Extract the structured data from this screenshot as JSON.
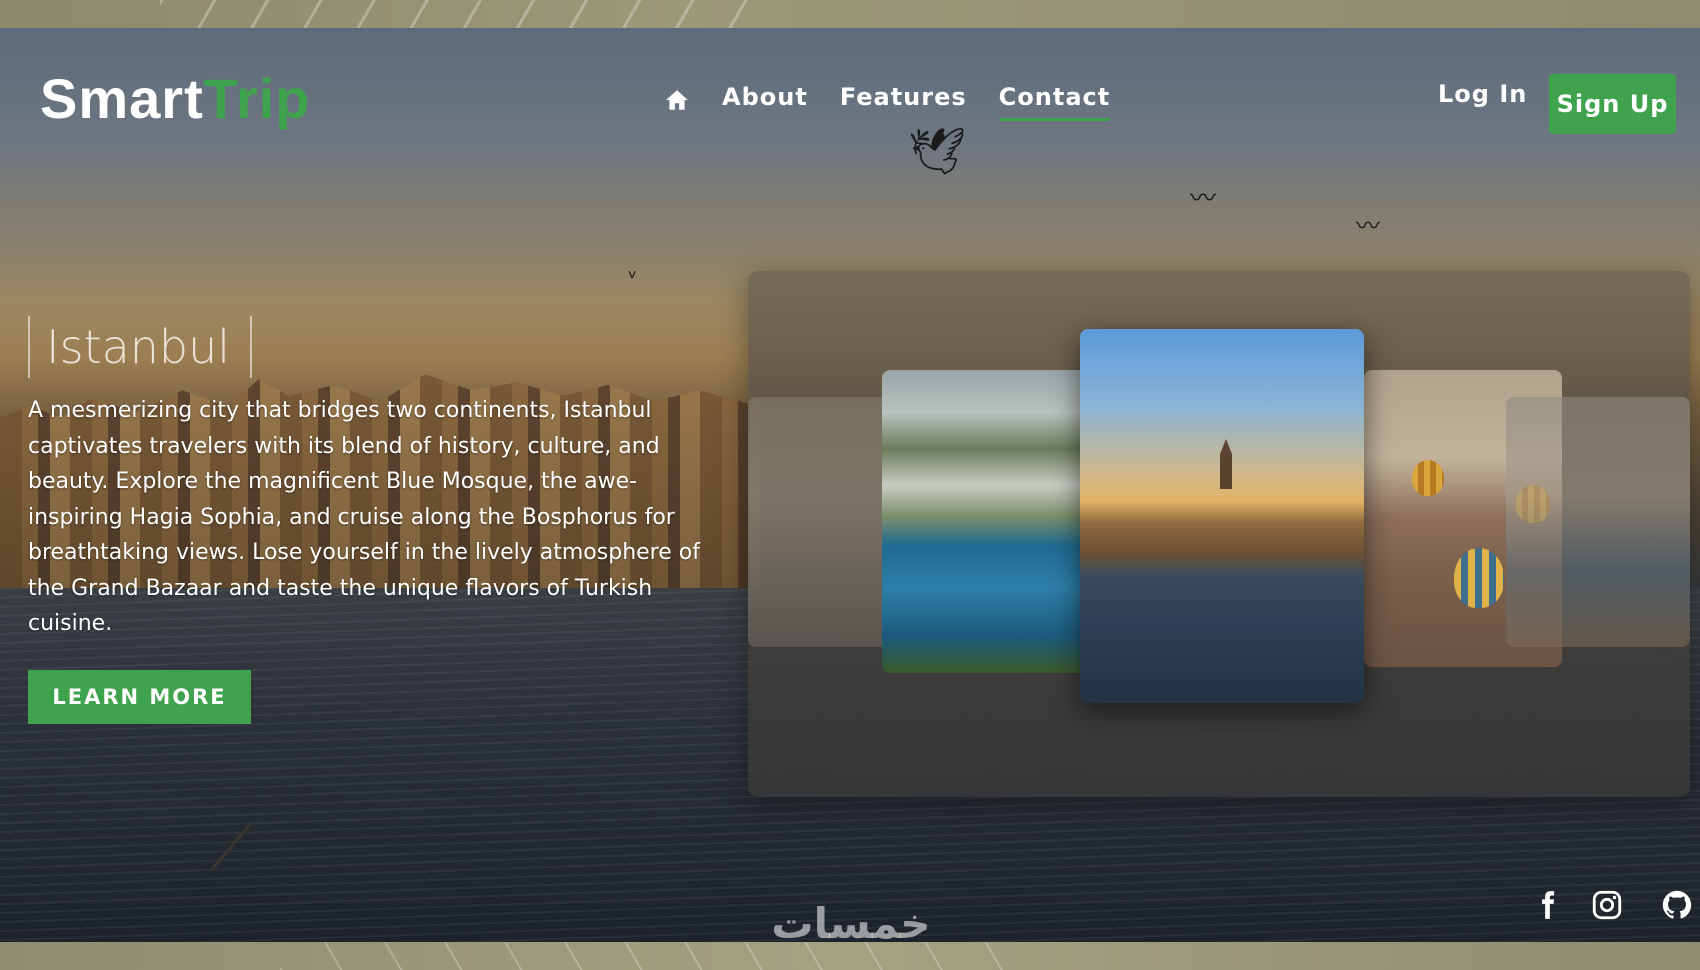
{
  "brand": {
    "part1": "Smart",
    "part2": "Trip",
    "accent": "#3fa34d"
  },
  "nav": {
    "home_icon": "home-icon",
    "items": [
      {
        "label": "About",
        "active": false
      },
      {
        "label": "Features",
        "active": false
      },
      {
        "label": "Contact",
        "active": true
      }
    ]
  },
  "auth": {
    "login_label": "Log In",
    "signup_label": "Sign Up"
  },
  "hero": {
    "place": "Istanbul",
    "description": "A mesmerizing city that bridges two continents, Istanbul captivates travelers with its blend of history, culture, and beauty. Explore the magnificent Blue Mosque, the awe-inspiring Hagia Sophia, and cruise along the Bosphorus for breathtaking views. Lose yourself in the lively atmosphere of the Grand Bazaar and taste the unique flavors of Turkish cuisine.",
    "cta_label": "LEARN MORE"
  },
  "carousel": {
    "slides": [
      {
        "scene": "cliff-left"
      },
      {
        "scene": "coastal-town"
      },
      {
        "scene": "istanbul-galata"
      },
      {
        "scene": "cappadocia-balloons"
      },
      {
        "scene": "harbor-right"
      }
    ]
  },
  "social": {
    "icons": [
      "facebook-icon",
      "instagram-icon",
      "github-icon"
    ]
  },
  "watermark": "خمسات"
}
